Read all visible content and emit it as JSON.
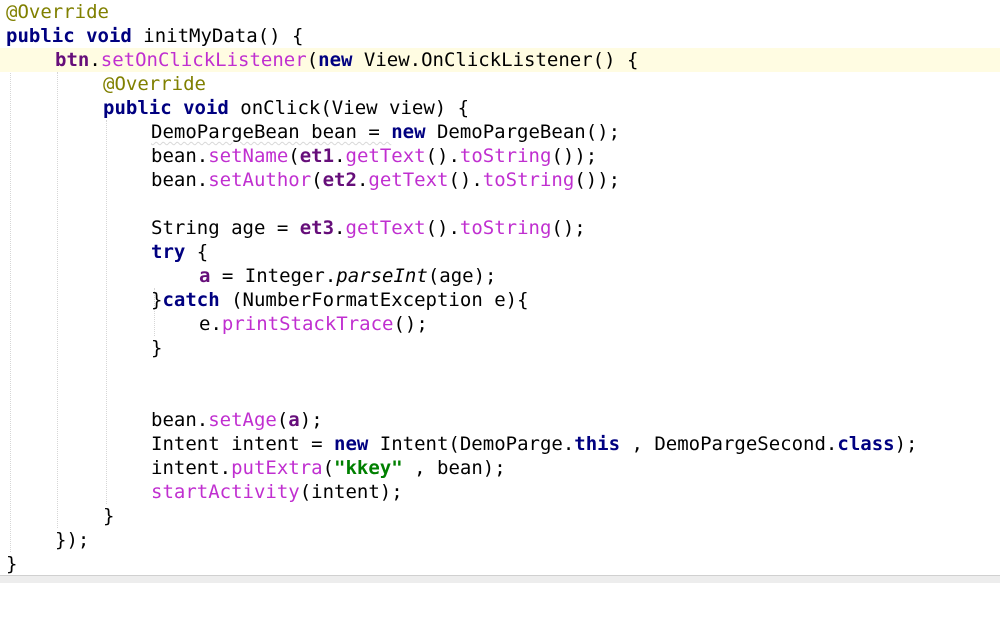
{
  "code": {
    "l1_override": "@Override",
    "l2_public": "public",
    "l2_void": "void",
    "l2_rest": " initMyData() {",
    "l3_btn": "btn",
    "l3_dot": ".",
    "l3_method": "setOnClickListener",
    "l3_paren": "(",
    "l3_new": "new",
    "l3_rest": " View.OnClickListener() {",
    "l4_override": "@Override",
    "l5_public": "public",
    "l5_void": "void",
    "l5_rest": " onClick(View view) {",
    "l6_a": "DemoPargeBean bean = ",
    "l6_new": "new",
    "l6_b": " DemoPargeBean();",
    "l7_a": "bean.",
    "l7_m1": "setName",
    "l7_b": "(",
    "l7_f": "et1",
    "l7_c": ".",
    "l7_m2": "getText",
    "l7_d": "().",
    "l7_m3": "toString",
    "l7_e": "());",
    "l8_a": "bean.",
    "l8_m1": "setAuthor",
    "l8_b": "(",
    "l8_f": "et2",
    "l8_c": ".",
    "l8_m2": "getText",
    "l8_d": "().",
    "l8_m3": "toString",
    "l8_e": "());",
    "l10_a": "String age = ",
    "l10_f": "et3",
    "l10_b": ".",
    "l10_m1": "getText",
    "l10_c": "().",
    "l10_m2": "toString",
    "l10_d": "();",
    "l11_try": "try",
    "l11_rest": " {",
    "l12_a": "a",
    "l12_b": " = Integer.",
    "l12_m": "parseInt",
    "l12_c": "(age);",
    "l13_a": "}",
    "l13_catch": "catch",
    "l13_b": " (NumberFormatException e){",
    "l14_a": "e.",
    "l14_m": "printStackTrace",
    "l14_b": "();",
    "l15": "}",
    "l18_a": "bean.",
    "l18_m": "setAge",
    "l18_b": "(",
    "l18_f": "a",
    "l18_c": ");",
    "l19_a": "Intent intent = ",
    "l19_new": "new",
    "l19_b": " Intent(DemoParge.",
    "l19_this": "this",
    "l19_c": " , DemoPargeSecond.",
    "l19_class": "class",
    "l19_d": ");",
    "l20_a": "intent.",
    "l20_m": "putExtra",
    "l20_b": "(",
    "l20_str": "\"kkey\"",
    "l20_c": " , bean);",
    "l21_m": "startActivity",
    "l21_a": "(intent);",
    "l22": "}",
    "l23": "});",
    "l24": "}"
  },
  "colors": {
    "background": "#ffffff",
    "current_line": "#fffce2",
    "keyword": "#000080",
    "annotation": "#808000",
    "method_call": "#c02fd0",
    "field": "#660e7a",
    "string": "#008000"
  }
}
